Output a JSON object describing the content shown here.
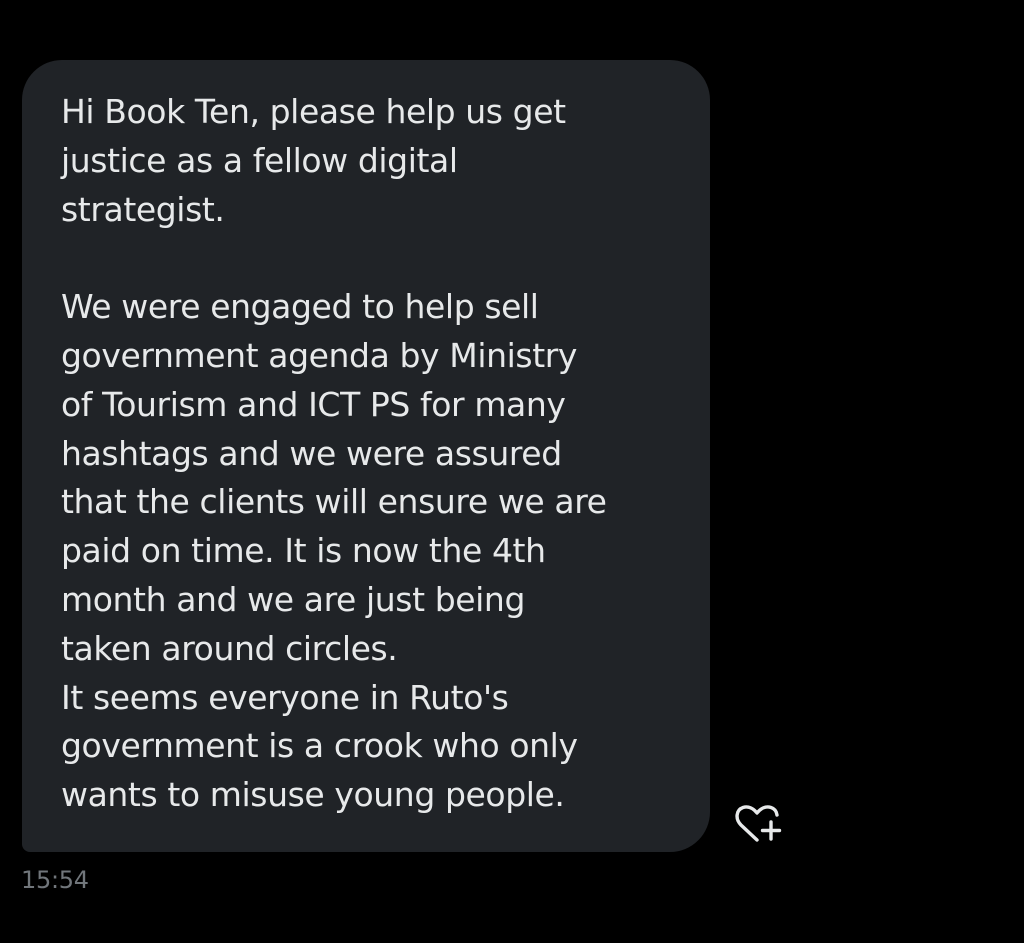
{
  "message": {
    "text": "Hi Book Ten, please help us get\njustice as a fellow digital\nstrategist.\n\nWe were engaged to help sell\ngovernment agenda by Ministry\nof Tourism and ICT PS for many\nhashtags and we were assured\nthat the clients will ensure we are\npaid on time. It is now the 4th\nmonth and we are just being\ntaken around circles.\nIt seems everyone in Ruto's\ngovernment is a crook who only\nwants to misuse young people.",
    "timestamp": "15:54",
    "react_icon": "heart-plus-icon"
  },
  "colors": {
    "background": "#000000",
    "bubble": "#202327",
    "text": "#e7e9ea",
    "timestamp": "#71767b",
    "icon": "#e7e9ea"
  }
}
